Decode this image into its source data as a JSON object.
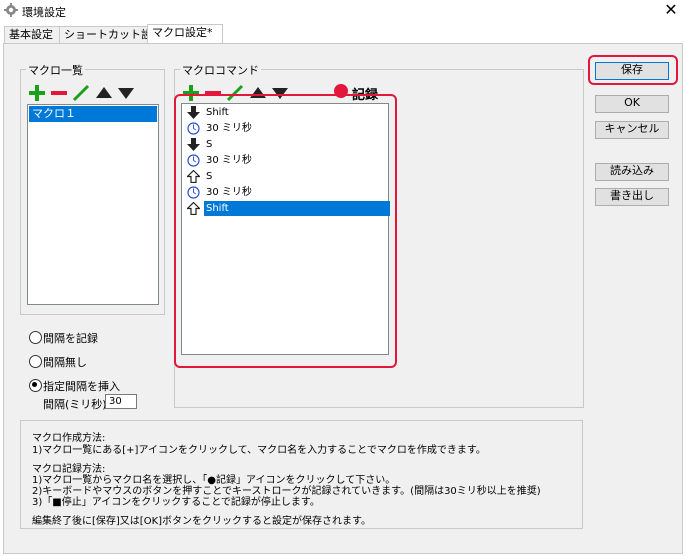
{
  "window": {
    "title": "環境設定",
    "close_glyph": "✕"
  },
  "tabs": [
    {
      "label": "基本設定",
      "active": false
    },
    {
      "label": "ショートカット設定",
      "active": false
    },
    {
      "label": "マクロ設定*",
      "active": true
    }
  ],
  "macro_list": {
    "label": "マクロ一覧",
    "items": [
      "マクロ１"
    ],
    "selected_index": 0
  },
  "macro_commands": {
    "label": "マクロコマンド",
    "record_label": "記録",
    "items": [
      {
        "icon": "key-down-icon",
        "text": "Shift",
        "selected": false
      },
      {
        "icon": "clock-icon",
        "text": "30 ミリ秒",
        "selected": false
      },
      {
        "icon": "key-down-icon",
        "text": "S",
        "selected": false
      },
      {
        "icon": "clock-icon",
        "text": "30 ミリ秒",
        "selected": false
      },
      {
        "icon": "key-up-icon",
        "text": "S",
        "selected": false
      },
      {
        "icon": "clock-icon",
        "text": "30 ミリ秒",
        "selected": false
      },
      {
        "icon": "key-up-icon",
        "text": "Shift",
        "selected": true
      }
    ]
  },
  "buttons": {
    "save": "保存",
    "ok": "OK",
    "cancel": "キャンセル",
    "import": "読み込み",
    "export": "書き出し"
  },
  "interval_options": {
    "record_interval": "間隔を記録",
    "no_interval": "間隔無し",
    "insert_interval": "指定間隔を挿入",
    "selected": "insert_interval",
    "interval_label": "間隔(ミリ秒):",
    "interval_value": "30"
  },
  "help": {
    "create_title": "マクロ作成方法:",
    "create_line1": "1)マクロ一覧にある[+]アイコンをクリックして、マクロ名を入力することでマクロを作成できます。",
    "record_title": "マクロ記録方法:",
    "record_line1": "1)マクロ一覧からマクロ名を選択し、「●記録」アイコンをクリックして下さい。",
    "record_line2": "2)キーボードやマウスのボタンを押すことでキーストロークが記録されていきます。(間隔は30ミリ秒以上を推奨)",
    "record_line3": "3)「■停止」アイコンをクリックすることで記録が停止します。",
    "footer": "編集終了後に[保存]又は[OK]ボタンをクリックすると設定が保存されます。"
  },
  "colors": {
    "accent": "#0078d7",
    "highlight_box": "#e3163c",
    "add_icon": "#1aa11a",
    "remove_icon": "#e3163c",
    "edit_icon": "#1aa11a",
    "record_dot": "#e3163c"
  }
}
